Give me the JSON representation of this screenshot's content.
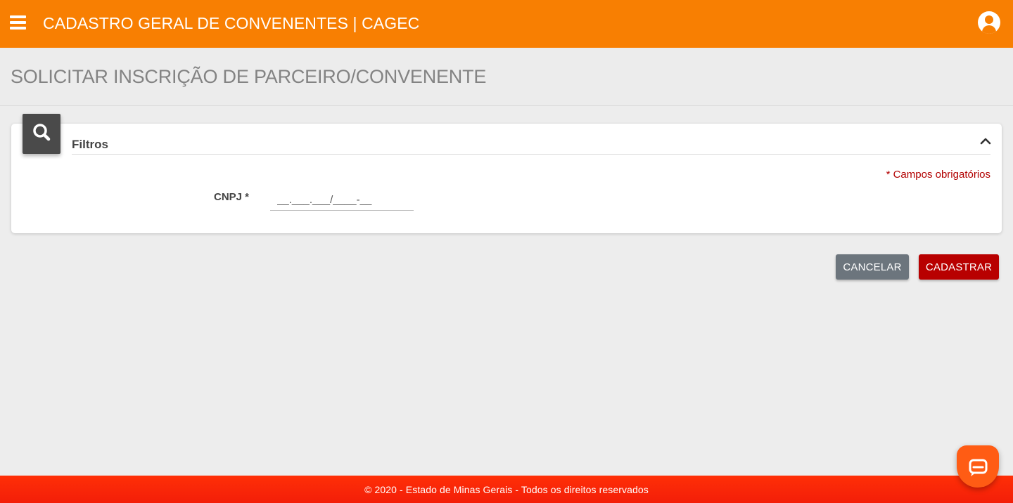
{
  "header": {
    "title": "CADASTRO GERAL DE CONVENENTES | CAGEC",
    "menu_icon": "hamburger-menu-icon",
    "user_icon": "account-circle-icon",
    "background_color": "#f87f02"
  },
  "page": {
    "title": "SOLICITAR INSCRIÇÃO DE PARCEIRO/CONVENENTE"
  },
  "filters_card": {
    "icon": "search-icon",
    "title": "Filtros",
    "collapse_icon": "chevron-up-icon",
    "required_note": "* Campos obrigatórios",
    "fields": [
      {
        "label": "CNPJ *",
        "value": "",
        "placeholder": "__.___.___/____-__"
      }
    ]
  },
  "actions": {
    "cancel_label": "CANCELAR",
    "submit_label": "CADASTRAR",
    "cancel_color": "#6c757d",
    "submit_color": "#b80000"
  },
  "chat": {
    "icon": "chat-bubble-icon"
  },
  "footer": {
    "text": "© 2020 - Estado de Minas Gerais - Todos os direitos reservados",
    "background_color": "#ff2f07"
  }
}
